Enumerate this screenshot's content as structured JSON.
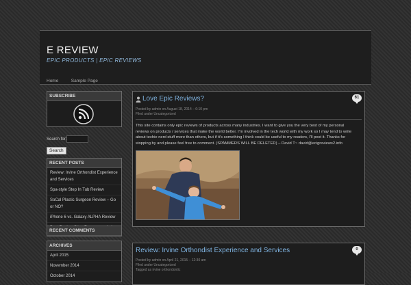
{
  "site": {
    "title": "E REVIEW",
    "tagline": "EPIC PRODUCTS | EPIC REVIEWS"
  },
  "nav": [
    "Home",
    "Sample Page"
  ],
  "sidebar": {
    "subscribe_title": "SUBSCRIBE",
    "search_label": "Search for:",
    "search_button": "Search",
    "recent_posts_title": "RECENT POSTS",
    "recent_posts": [
      "Review: Irvine Orthondist Experience and Services",
      "Spa-style Step In Tub Review",
      "SoCal Plastic Surgeon Review – Go or NO?",
      "iPhone 6 vs. Galaxy ALPHA Review",
      "Best Review Sites Recommended"
    ],
    "recent_comments_title": "RECENT COMMENTS",
    "archives_title": "ARCHIVES",
    "archives": [
      "April 2015",
      "November 2014",
      "October 2014"
    ]
  },
  "posts": [
    {
      "title": "Love Epic Reviews?",
      "meta": "Posted by admin on August 18, 2014 – 6:10 pm",
      "filed": "Filed under Uncategorized",
      "comments": "61",
      "body": "This site contains only epic reviews of products across many industries. I want to give you the very best of my personal reviews on products / services that make the world better. I'm involved in the tech world with my work so I may tend to write about techie nerd stuff more than others, but if it's something I think could be useful to my readers, I'll post it. Thanks for stopping by and please feel free to comment. (SPAMMERS WILL BE DELETED) – David T~ david@ecigreviews2.info"
    },
    {
      "title": "Review: Irvine Orthondist Experience and Services",
      "meta": "Posted by admin on April 21, 2015 – 12:30 am",
      "filed": "Filed under Uncategorized",
      "tagged": "Tagged as irvine orthondontic",
      "comments": "0"
    }
  ],
  "colors": {
    "link": "#7fb3e0",
    "background": "#2e2e2e",
    "panel": "#1d1d1d"
  }
}
